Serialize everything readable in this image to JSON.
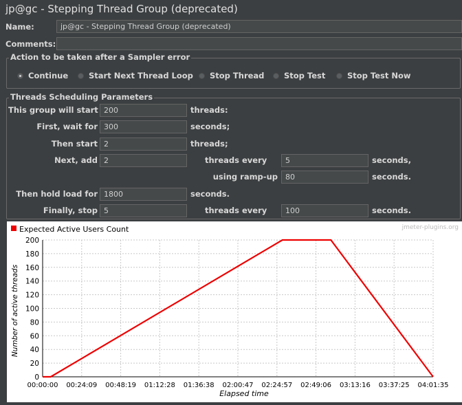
{
  "window": {
    "title": "jp@gc - Stepping Thread Group (deprecated)"
  },
  "name_row": {
    "label": "Name:",
    "value": "jp@gc - Stepping Thread Group (deprecated)"
  },
  "comments_row": {
    "label": "Comments:",
    "value": ""
  },
  "sampler_error": {
    "legend": "Action to be taken after a Sampler error",
    "options": [
      "Continue",
      "Start Next Thread Loop",
      "Stop Thread",
      "Stop Test",
      "Stop Test Now"
    ],
    "selected": "Continue"
  },
  "schedule": {
    "legend": "Threads Scheduling Parameters",
    "group_start_label": "This group will start",
    "group_start_value": "200",
    "group_start_unit": "threads:",
    "first_wait_label": "First, wait for",
    "first_wait_value": "300",
    "first_wait_unit": "seconds;",
    "then_start_label": "Then start",
    "then_start_value": "2",
    "then_start_unit": "threads;",
    "next_add_label": "Next, add",
    "next_add_value": "2",
    "next_add_every_label": "threads every",
    "next_add_every_value": "5",
    "next_add_every_unit": "seconds,",
    "ramp_up_label": "using ramp-up",
    "ramp_up_value": "80",
    "ramp_up_unit": "seconds.",
    "hold_load_label": "Then hold load for",
    "hold_load_value": "1800",
    "hold_load_unit": "seconds.",
    "finally_stop_label": "Finally, stop",
    "finally_stop_value": "5",
    "finally_stop_every_label": "threads every",
    "finally_stop_every_value": "100",
    "finally_stop_every_unit": "seconds."
  },
  "chart": {
    "watermark": "jmeter-plugins.org",
    "colors": {
      "line": "#ee0000",
      "grid": "#c8c8c8"
    }
  },
  "chart_data": {
    "type": "line",
    "title": "",
    "xlabel": "Elapsed time",
    "ylabel": "Number of active threads",
    "legend": [
      "Expected Active Users Count"
    ],
    "legend_position": "top-left",
    "grid": true,
    "ylim": [
      0,
      200
    ],
    "yticks": [
      "0",
      "20",
      "40",
      "60",
      "80",
      "100",
      "120",
      "140",
      "160",
      "180",
      "200"
    ],
    "xticks": [
      "00:00:00",
      "00:24:09",
      "00:48:19",
      "01:12:28",
      "01:36:38",
      "02:00:47",
      "02:24:57",
      "02:49:06",
      "03:13:16",
      "03:37:25",
      "04:01:35"
    ],
    "xlim": [
      "00:00:00",
      "04:01:35"
    ],
    "series": [
      {
        "name": "Expected Active Users Count",
        "x": [
          "00:00:00",
          "00:05:00",
          "02:28:20",
          "02:58:20",
          "04:01:35"
        ],
        "y": [
          0,
          0,
          200,
          200,
          0
        ]
      }
    ]
  }
}
